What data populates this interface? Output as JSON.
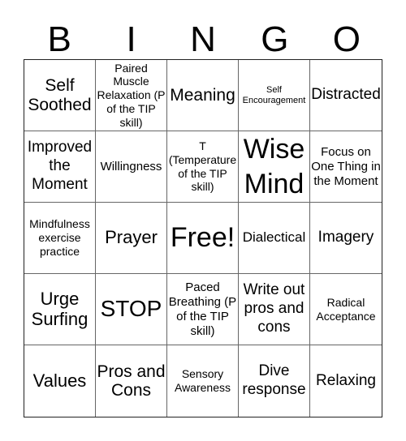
{
  "header": {
    "letters": [
      "B",
      "I",
      "N",
      "G",
      "O"
    ]
  },
  "cells": [
    "Self Soothed",
    "Paired Muscle Relaxation (P of the TIP skill)",
    "Meaning",
    "Self Encouragement",
    "Distracted",
    "Improved the Moment",
    "Willingness",
    "T (Temperature of the TIP skill)",
    "Wise Mind",
    "Focus on One Thing in the Moment",
    "Mindfulness exercise practice",
    "Prayer",
    "Free!",
    "Dialectical",
    "Imagery",
    "Urge Surfing",
    "STOP",
    "Paced Breathing (P of the TIP skill)",
    "Write out pros and cons",
    "Radical Acceptance",
    "Values",
    "Pros and Cons",
    "Sensory Awareness",
    "Dive response",
    "Relaxing"
  ]
}
